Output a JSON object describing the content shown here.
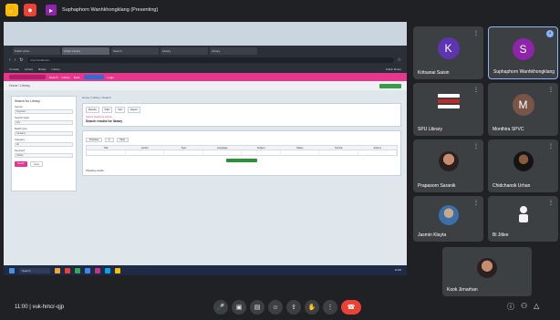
{
  "topbar": {
    "presenting_label": "Suphaphorn Wanhkhongklang (Presenting)",
    "icon_left": "#fbbc04",
    "icon_right": "#ea4335",
    "presenter_color": "#8e24aa"
  },
  "shared": {
    "tabs": [
      "Public Libra...",
      "Public Library",
      "Search",
      "Library",
      "Library"
    ],
    "url": "http://localhost/...",
    "bookmarks": [
      "Console",
      "Library",
      "Books",
      "Library"
    ],
    "bookmarks_right": "Public library",
    "appbar_items": [
      "Search",
      "Library",
      "Book",
      "Login"
    ],
    "subbar_text": "Home / Library",
    "left_panel": {
      "title": "Search for Library",
      "labels": [
        "Source",
        "Search Field",
        "Match type",
        "Category",
        "Keyword"
      ],
      "fields": [
        "Keyword",
        "Any",
        "Contains",
        "All",
        "Library"
      ],
      "search_btn": "Search",
      "clear_btn": "Clear"
    },
    "main": {
      "crumbs": "Home / Library / Search",
      "tabs": [
        "Results",
        "Filter",
        "Sort",
        "Export"
      ],
      "pink_line": "Search results for Library",
      "headline": "Search results for library",
      "pager": [
        "Previous",
        "1",
        "Next"
      ],
      "grid_headers": [
        "Title",
        "Author",
        "Type",
        "Language",
        "Subject",
        "Status",
        "Format",
        "Actions"
      ],
      "grid_row": [
        "",
        "",
        "",
        "",
        "",
        "",
        "",
        ""
      ],
      "footnote": "Showing results"
    },
    "taskbar": {
      "search": "Search",
      "time": "11:00",
      "date": ""
    }
  },
  "participants": [
    {
      "name": "Kritsanai Saisin",
      "initial": "K",
      "avatar_color": "#5e35b1"
    },
    {
      "name": "Suphaphorn Wanhkhongklang",
      "initial": "S",
      "avatar_color": "#8e24aa",
      "active": true
    },
    {
      "name": "SPU Library"
    },
    {
      "name": "Monthira SPVC",
      "initial": "M",
      "avatar_color": "#795548"
    },
    {
      "name": "Prapasorn Saranik"
    },
    {
      "name": "Chidchanok Urhan"
    },
    {
      "name": "Jasmin Klayta"
    },
    {
      "name": "Bi Jitlee"
    },
    {
      "name": "Kook Jirnarhan"
    }
  ],
  "bottom": {
    "meeting_info": "11:00 | vuk-hmcr-qjp",
    "controls": [
      "mic",
      "camera",
      "captions",
      "emoji",
      "present",
      "raise-hand",
      "more"
    ],
    "right_icons": [
      "info",
      "people",
      "activities"
    ]
  }
}
